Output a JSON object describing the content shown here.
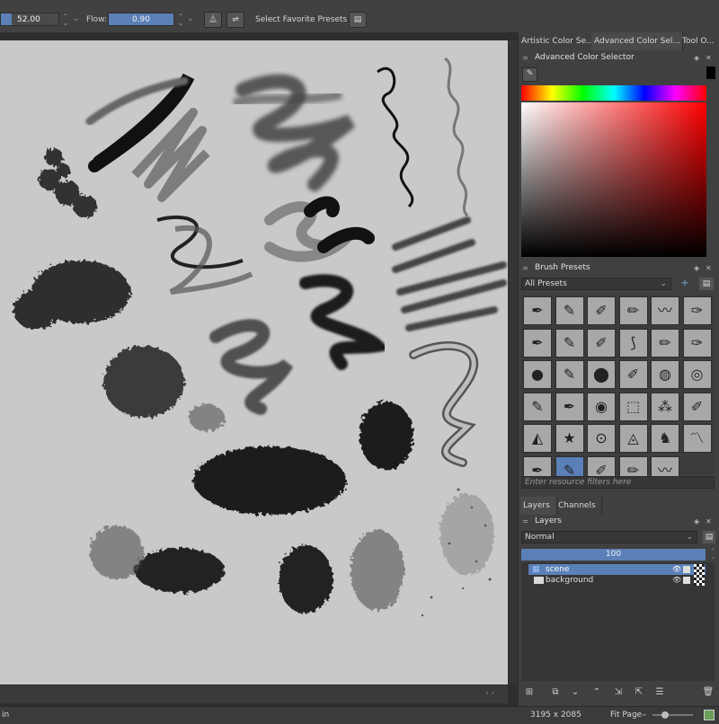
{
  "toolbar": {
    "size_value": "52.00",
    "flow_label": "Flow:",
    "flow_value": "0.90",
    "favorite_presets_label": "Select Favorite Presets"
  },
  "dock": {
    "tabs": [
      {
        "label": "Artistic Color Se..."
      },
      {
        "label": "Advanced Color Sel..."
      },
      {
        "label": "Tool O..."
      }
    ],
    "color_selector": {
      "title": "Advanced Color Selector"
    },
    "brush_presets": {
      "title": "Brush Presets",
      "filter_value": "All Presets",
      "search_placeholder": "Enter resource filters here",
      "count": 35,
      "selected_index": 31
    },
    "layers_tabs": [
      {
        "label": "Layers"
      },
      {
        "label": "Channels"
      }
    ],
    "layers": {
      "title": "Layers",
      "blend_mode": "Normal",
      "opacity": "100",
      "items": [
        {
          "name": "scene",
          "selected": true
        },
        {
          "name": "background",
          "selected": false
        }
      ]
    }
  },
  "status": {
    "left_text": "in",
    "dimensions": "3195 x 2085",
    "zoom_mode": "Fit Page"
  },
  "colors": {
    "accent": "#5b80b8",
    "panel": "#404040",
    "canvas": "#c9c9c9"
  }
}
